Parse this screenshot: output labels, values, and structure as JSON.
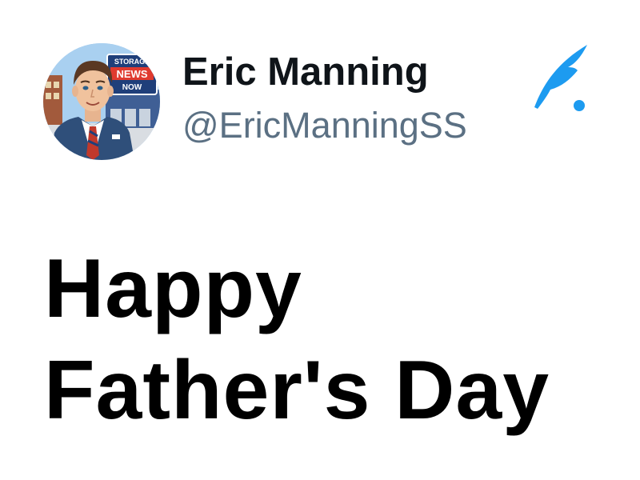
{
  "author": {
    "display_name": "Eric Manning",
    "handle": "@EricManningSS",
    "avatar": {
      "icon": "cartoon-man-avatar",
      "sign_lines": [
        "STORAGE",
        "NEWS",
        "NOW"
      ]
    }
  },
  "brand": {
    "icon": "quill-feather-icon",
    "color": "#1d9bf0"
  },
  "post": {
    "lines": [
      "Happy",
      "Father's Day"
    ]
  },
  "colors": {
    "name": "#0f1419",
    "handle": "#5b7083",
    "message": "#000000"
  }
}
